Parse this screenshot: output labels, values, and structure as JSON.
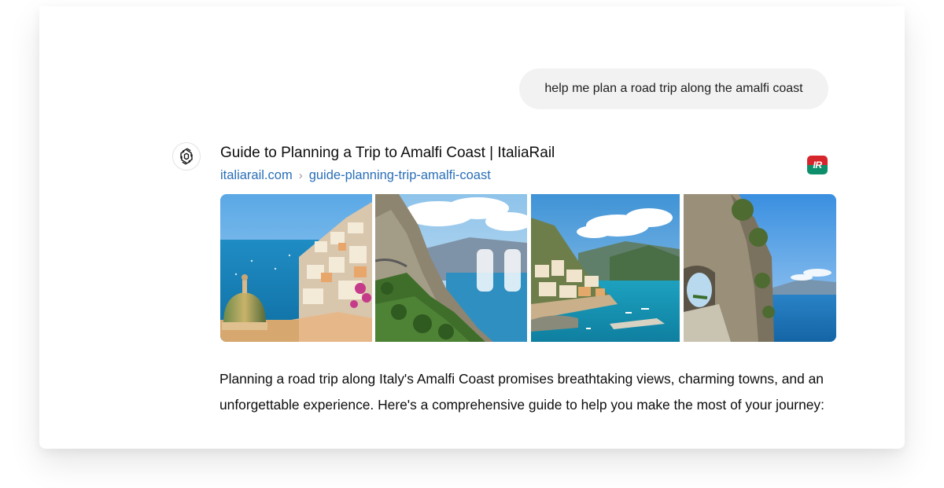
{
  "user_message": "help me plan a road trip along the amalfi coast",
  "assistant": {
    "avatar_icon": "openai-logo-icon",
    "result": {
      "title": "Guide to Planning a Trip to Amalfi Coast | ItaliaRail",
      "domain": "italiarail.com",
      "path": "guide-planning-trip-amalfi-coast",
      "favicon_text": "IR",
      "favicon_colors": [
        "#d6262b",
        "#0e8f6b"
      ]
    },
    "gallery": {
      "images": [
        "positano-dome-photo",
        "cliff-road-photo",
        "amalfi-town-photo",
        "rock-tunnel-photo"
      ],
      "control": "pause-icon"
    },
    "text": "Planning a road trip along Italy's Amalfi Coast promises breathtaking views, charming towns, and an unforgettable experience. Here's a comprehensive guide to help you make the most of your journey:"
  },
  "colors": {
    "link": "#2a6fb8",
    "bubble": "#f2f2f2"
  }
}
